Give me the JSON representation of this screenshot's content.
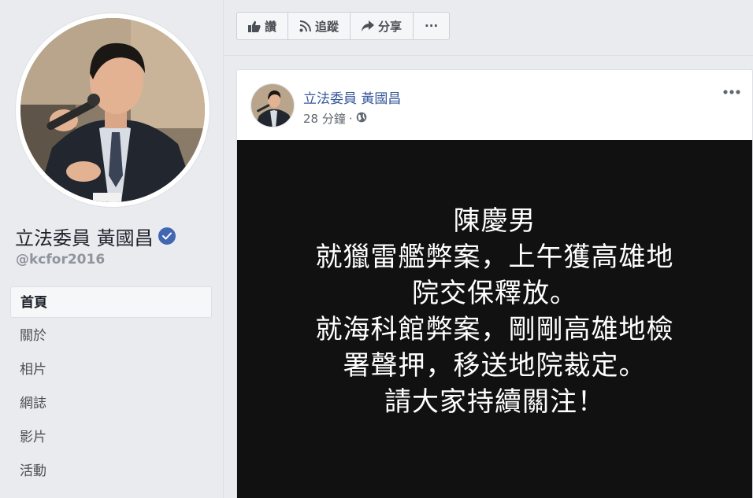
{
  "profile": {
    "name": "立法委員 黃國昌",
    "handle": "@kcfor2016",
    "verified": true
  },
  "nav": {
    "items": [
      {
        "label": "首頁",
        "active": true
      },
      {
        "label": "關於",
        "active": false
      },
      {
        "label": "相片",
        "active": false
      },
      {
        "label": "網誌",
        "active": false
      },
      {
        "label": "影片",
        "active": false
      },
      {
        "label": "活動",
        "active": false
      }
    ]
  },
  "actions": {
    "like_label": "讚",
    "follow_label": "追蹤",
    "share_label": "分享",
    "more_label": "···"
  },
  "post": {
    "author": "立法委員 黃國昌",
    "time": "28 分鐘",
    "separator": "·",
    "privacy_icon": "globe-icon",
    "menu_label": "···",
    "image_text_lines": [
      "陳慶男",
      "就獵雷艦弊案，上午獲高雄地",
      "院交保釋放。",
      "就海科館弊案，剛剛高雄地檢",
      "署聲押，移送地院裁定。",
      "請大家持續關注！"
    ]
  },
  "colors": {
    "background": "#e9ebee",
    "link": "#365899",
    "verified": "#4267b2",
    "image_bg": "#111111"
  }
}
